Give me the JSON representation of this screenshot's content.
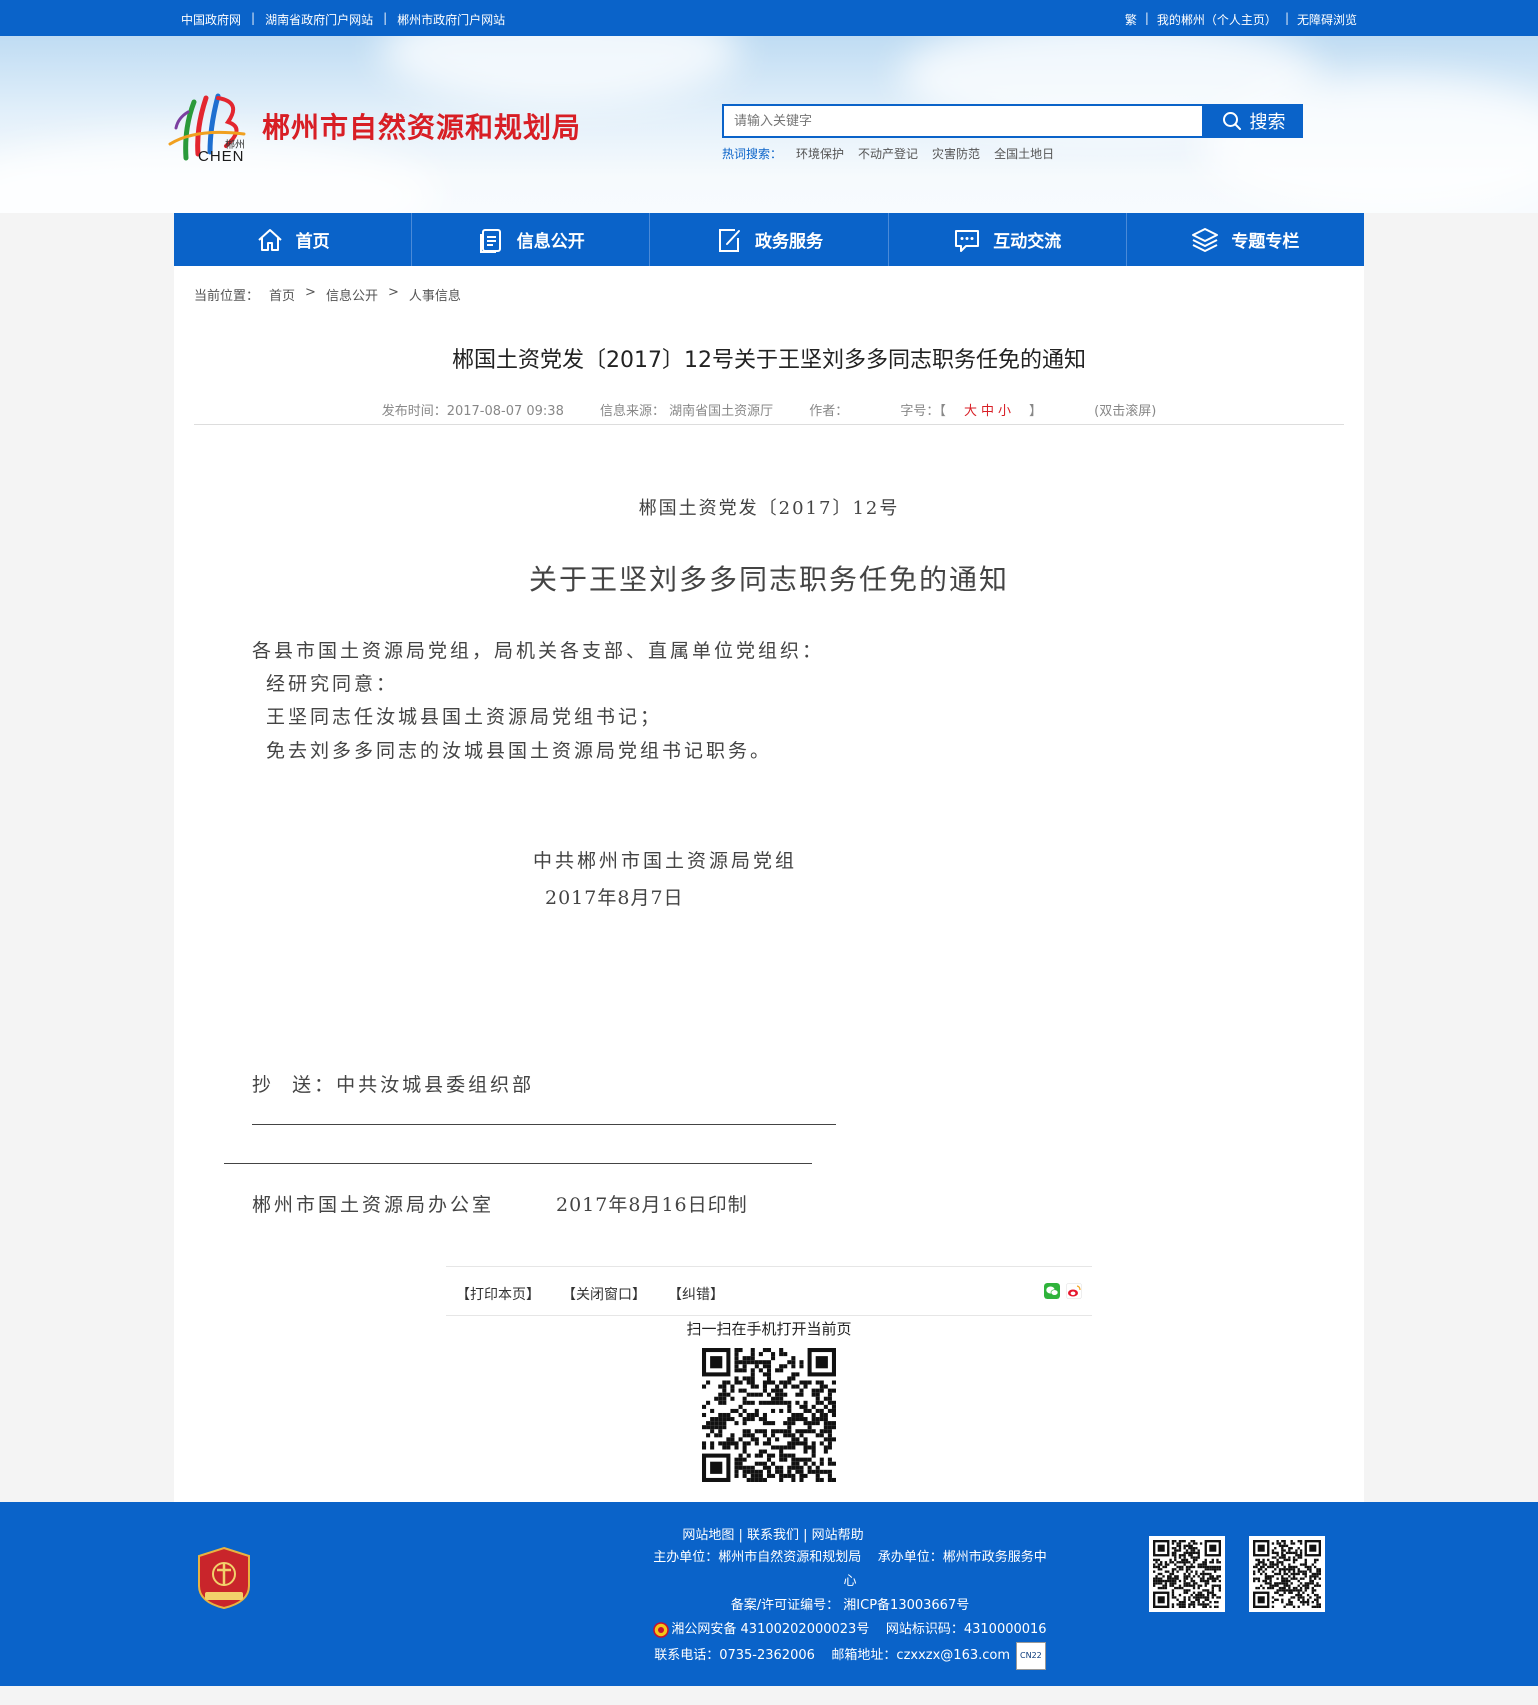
{
  "topbar": {
    "left_links": [
      "中国政府网",
      "湖南省政府门户网站",
      "郴州市政府门户网站"
    ],
    "right_links": [
      "繁",
      "我的郴州（个人主页）",
      "无障碍浏览"
    ],
    "separator": "|"
  },
  "header": {
    "logo_cn": "郴州",
    "logo_en": "CHEN",
    "site_title": "郴州市自然资源和规划局",
    "search_placeholder": "请输入关键字",
    "search_button": "搜索",
    "hot_label": "热词搜索：",
    "hot_words": [
      "环境保护",
      "不动产登记",
      "灾害防范",
      "全国土地日"
    ]
  },
  "nav": {
    "items": [
      {
        "label": "首页",
        "icon": "home-icon"
      },
      {
        "label": "信息公开",
        "icon": "document-icon"
      },
      {
        "label": "政务服务",
        "icon": "edit-icon"
      },
      {
        "label": "互动交流",
        "icon": "chat-icon"
      },
      {
        "label": "专题专栏",
        "icon": "layers-icon"
      }
    ]
  },
  "breadcrumb": {
    "label": "当前位置：",
    "items": [
      "首页",
      "信息公开",
      "人事信息"
    ],
    "sep": ">"
  },
  "article": {
    "title": "郴国土资党发〔2017〕12号关于王坚刘多多同志职务任免的通知",
    "publish": "发布时间：2017-08-07 09:38",
    "source": "信息来源： 湖南省国土资源厅",
    "author": "作者：",
    "font_label": "字号：【",
    "font_large": "大",
    "font_mid": "中",
    "font_small": "小",
    "font_end": "】",
    "dblclick": "(双击滚屏)"
  },
  "doc": {
    "number": "郴国土资党发〔2017〕12号",
    "title": "关于王坚刘多多同志职务任免的通知",
    "salutation": "各县市国土资源局党组，局机关各支部、直属单位党组织：",
    "lines": [
      "经研究同意：",
      "王坚同志任汝城县国土资源局党组书记；",
      "免去刘多多同志的汝城县国土资源局党组书记职务。"
    ],
    "signature": "中共郴州市国土资源局党组",
    "date": "2017年8月7日",
    "cc": "抄  送：中共汝城县委组织部",
    "office": "郴州市国土资源局办公室",
    "print_date": "2017年8月16日印制"
  },
  "tools": {
    "print": "【打印本页】",
    "close": "【关闭窗口】",
    "error": "【纠错】",
    "scan": "扫一扫在手机打开当前页"
  },
  "footer": {
    "links": "网站地图 | 联系我们 | 网站帮助",
    "host_line1": "主办单位：郴州市自然资源和规划局    承办单位：郴州市政务服务中",
    "host_line2": "心",
    "icp": "备案/许可证编号： 湘ICP备13003667号",
    "police": "湘公网安备 43100202000023号    网站标识码：4310000016",
    "contact": "联系电话：0735-2362006    邮箱地址：czxxzx@163.com",
    "badge": "CN22"
  },
  "colors": {
    "primary": "#0a63c9",
    "accent_red": "#d81e25"
  }
}
